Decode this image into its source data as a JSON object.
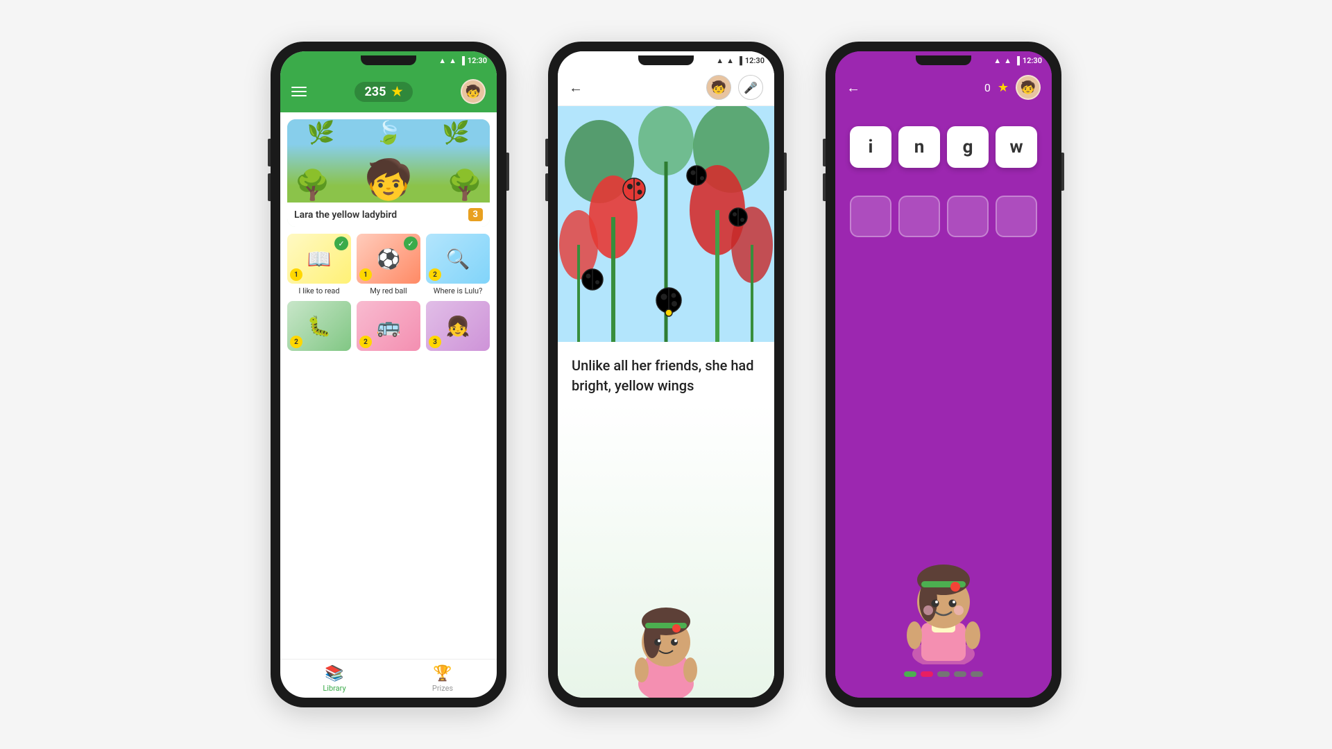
{
  "page": {
    "background": "#f5f5f5"
  },
  "phone1": {
    "status": {
      "time": "12:30"
    },
    "header": {
      "score": "235"
    },
    "featured": {
      "title": "Lara the yellow ladybird",
      "badge": "3"
    },
    "books": [
      {
        "label": "I like to read",
        "badge_type": "check",
        "num": "1"
      },
      {
        "label": "My red ball",
        "badge_type": "check",
        "num": "1"
      },
      {
        "label": "Where is Lulu?",
        "badge_type": "num",
        "num": "2"
      },
      {
        "label": "",
        "badge_type": "num",
        "num": "2"
      },
      {
        "label": "",
        "badge_type": "num",
        "num": "2"
      },
      {
        "label": "",
        "badge_type": "num",
        "num": "3"
      }
    ],
    "tabs": [
      {
        "label": "Library",
        "active": true
      },
      {
        "label": "Prizes",
        "active": false
      }
    ]
  },
  "phone2": {
    "status": {
      "time": "12:30"
    },
    "story_text": "Unlike all her friends, she had bright, yellow wings"
  },
  "phone3": {
    "status": {
      "time": "12:30"
    },
    "score": "0",
    "letters": [
      "i",
      "n",
      "g",
      "w"
    ],
    "progress_colors": [
      "#4caf50",
      "#e91e63",
      "#9e9e9e",
      "#9e9e9e",
      "#9e9e9e"
    ]
  }
}
